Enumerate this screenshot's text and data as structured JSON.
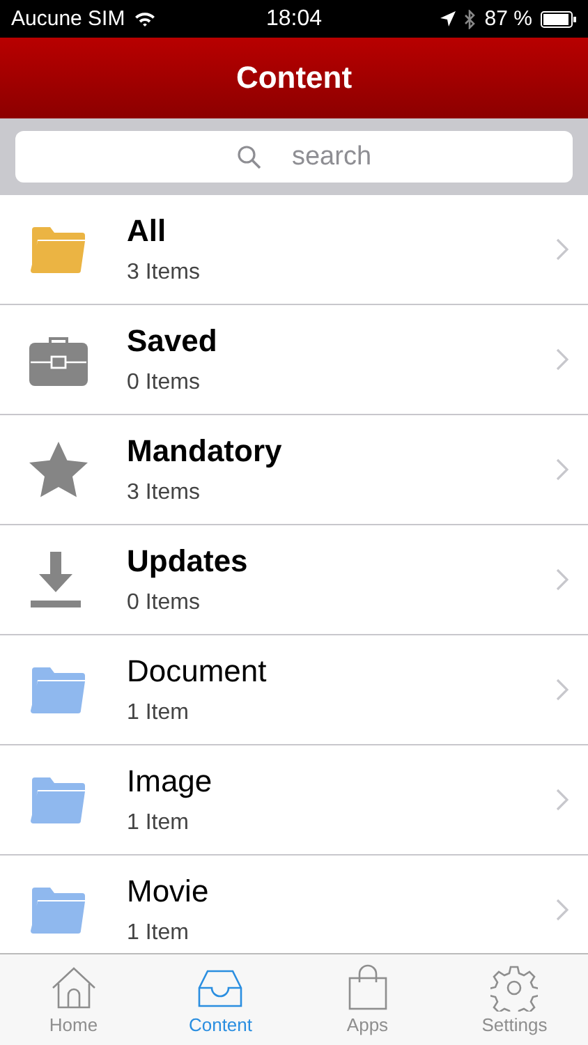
{
  "status_bar": {
    "carrier": "Aucune SIM",
    "time": "18:04",
    "battery": "87 %"
  },
  "header": {
    "title": "Content"
  },
  "search": {
    "placeholder": "search"
  },
  "rows": [
    {
      "kind": "folder",
      "color": "#ebb443",
      "title": "All",
      "bold": true,
      "count": "3 Items"
    },
    {
      "kind": "briefcase",
      "title": "Saved",
      "bold": true,
      "count": "0 Items"
    },
    {
      "kind": "star",
      "title": "Mandatory",
      "bold": true,
      "count": "3 Items"
    },
    {
      "kind": "download",
      "title": "Updates",
      "bold": true,
      "count": "0 Items"
    },
    {
      "kind": "folder",
      "color": "#8fb8ee",
      "title": "Document",
      "bold": false,
      "count": "1 Item"
    },
    {
      "kind": "folder",
      "color": "#8fb8ee",
      "title": "Image",
      "bold": false,
      "count": "1 Item"
    },
    {
      "kind": "folder",
      "color": "#8fb8ee",
      "title": "Movie",
      "bold": false,
      "count": "1 Item"
    }
  ],
  "tabs": [
    {
      "kind": "home",
      "label": "Home",
      "selected": false
    },
    {
      "kind": "inbox",
      "label": "Content",
      "selected": true
    },
    {
      "kind": "bag",
      "label": "Apps",
      "selected": false
    },
    {
      "kind": "gear",
      "label": "Settings",
      "selected": false
    }
  ]
}
